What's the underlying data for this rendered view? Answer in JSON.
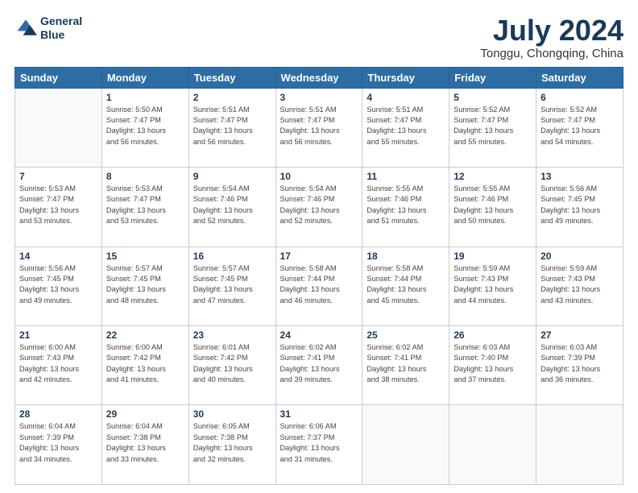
{
  "header": {
    "logo_line1": "General",
    "logo_line2": "Blue",
    "month": "July 2024",
    "location": "Tonggu, Chongqing, China"
  },
  "weekdays": [
    "Sunday",
    "Monday",
    "Tuesday",
    "Wednesday",
    "Thursday",
    "Friday",
    "Saturday"
  ],
  "weeks": [
    [
      {
        "day": "",
        "info": ""
      },
      {
        "day": "1",
        "info": "Sunrise: 5:50 AM\nSunset: 7:47 PM\nDaylight: 13 hours\nand 56 minutes."
      },
      {
        "day": "2",
        "info": "Sunrise: 5:51 AM\nSunset: 7:47 PM\nDaylight: 13 hours\nand 56 minutes."
      },
      {
        "day": "3",
        "info": "Sunrise: 5:51 AM\nSunset: 7:47 PM\nDaylight: 13 hours\nand 56 minutes."
      },
      {
        "day": "4",
        "info": "Sunrise: 5:51 AM\nSunset: 7:47 PM\nDaylight: 13 hours\nand 55 minutes."
      },
      {
        "day": "5",
        "info": "Sunrise: 5:52 AM\nSunset: 7:47 PM\nDaylight: 13 hours\nand 55 minutes."
      },
      {
        "day": "6",
        "info": "Sunrise: 5:52 AM\nSunset: 7:47 PM\nDaylight: 13 hours\nand 54 minutes."
      }
    ],
    [
      {
        "day": "7",
        "info": "Sunrise: 5:53 AM\nSunset: 7:47 PM\nDaylight: 13 hours\nand 53 minutes."
      },
      {
        "day": "8",
        "info": "Sunrise: 5:53 AM\nSunset: 7:47 PM\nDaylight: 13 hours\nand 53 minutes."
      },
      {
        "day": "9",
        "info": "Sunrise: 5:54 AM\nSunset: 7:46 PM\nDaylight: 13 hours\nand 52 minutes."
      },
      {
        "day": "10",
        "info": "Sunrise: 5:54 AM\nSunset: 7:46 PM\nDaylight: 13 hours\nand 52 minutes."
      },
      {
        "day": "11",
        "info": "Sunrise: 5:55 AM\nSunset: 7:46 PM\nDaylight: 13 hours\nand 51 minutes."
      },
      {
        "day": "12",
        "info": "Sunrise: 5:55 AM\nSunset: 7:46 PM\nDaylight: 13 hours\nand 50 minutes."
      },
      {
        "day": "13",
        "info": "Sunrise: 5:56 AM\nSunset: 7:45 PM\nDaylight: 13 hours\nand 49 minutes."
      }
    ],
    [
      {
        "day": "14",
        "info": "Sunrise: 5:56 AM\nSunset: 7:45 PM\nDaylight: 13 hours\nand 49 minutes."
      },
      {
        "day": "15",
        "info": "Sunrise: 5:57 AM\nSunset: 7:45 PM\nDaylight: 13 hours\nand 48 minutes."
      },
      {
        "day": "16",
        "info": "Sunrise: 5:57 AM\nSunset: 7:45 PM\nDaylight: 13 hours\nand 47 minutes."
      },
      {
        "day": "17",
        "info": "Sunrise: 5:58 AM\nSunset: 7:44 PM\nDaylight: 13 hours\nand 46 minutes."
      },
      {
        "day": "18",
        "info": "Sunrise: 5:58 AM\nSunset: 7:44 PM\nDaylight: 13 hours\nand 45 minutes."
      },
      {
        "day": "19",
        "info": "Sunrise: 5:59 AM\nSunset: 7:43 PM\nDaylight: 13 hours\nand 44 minutes."
      },
      {
        "day": "20",
        "info": "Sunrise: 5:59 AM\nSunset: 7:43 PM\nDaylight: 13 hours\nand 43 minutes."
      }
    ],
    [
      {
        "day": "21",
        "info": "Sunrise: 6:00 AM\nSunset: 7:43 PM\nDaylight: 13 hours\nand 42 minutes."
      },
      {
        "day": "22",
        "info": "Sunrise: 6:00 AM\nSunset: 7:42 PM\nDaylight: 13 hours\nand 41 minutes."
      },
      {
        "day": "23",
        "info": "Sunrise: 6:01 AM\nSunset: 7:42 PM\nDaylight: 13 hours\nand 40 minutes."
      },
      {
        "day": "24",
        "info": "Sunrise: 6:02 AM\nSunset: 7:41 PM\nDaylight: 13 hours\nand 39 minutes."
      },
      {
        "day": "25",
        "info": "Sunrise: 6:02 AM\nSunset: 7:41 PM\nDaylight: 13 hours\nand 38 minutes."
      },
      {
        "day": "26",
        "info": "Sunrise: 6:03 AM\nSunset: 7:40 PM\nDaylight: 13 hours\nand 37 minutes."
      },
      {
        "day": "27",
        "info": "Sunrise: 6:03 AM\nSunset: 7:39 PM\nDaylight: 13 hours\nand 36 minutes."
      }
    ],
    [
      {
        "day": "28",
        "info": "Sunrise: 6:04 AM\nSunset: 7:39 PM\nDaylight: 13 hours\nand 34 minutes."
      },
      {
        "day": "29",
        "info": "Sunrise: 6:04 AM\nSunset: 7:38 PM\nDaylight: 13 hours\nand 33 minutes."
      },
      {
        "day": "30",
        "info": "Sunrise: 6:05 AM\nSunset: 7:38 PM\nDaylight: 13 hours\nand 32 minutes."
      },
      {
        "day": "31",
        "info": "Sunrise: 6:06 AM\nSunset: 7:37 PM\nDaylight: 13 hours\nand 31 minutes."
      },
      {
        "day": "",
        "info": ""
      },
      {
        "day": "",
        "info": ""
      },
      {
        "day": "",
        "info": ""
      }
    ]
  ]
}
